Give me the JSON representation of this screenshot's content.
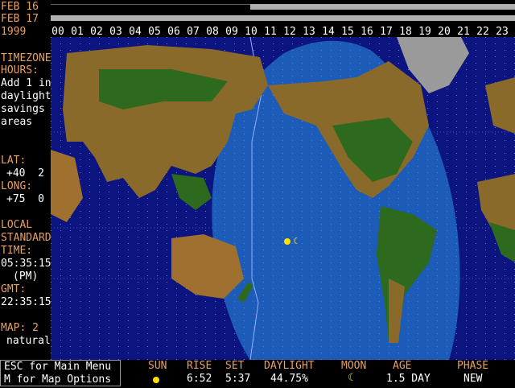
{
  "dates": {
    "row1_label": "FEB 16",
    "row2_label": "FEB 17",
    "year": "1999"
  },
  "hours": [
    "00",
    "01",
    "02",
    "03",
    "04",
    "05",
    "06",
    "07",
    "08",
    "09",
    "10",
    "11",
    "12",
    "13",
    "14",
    "15",
    "16",
    "17",
    "18",
    "19",
    "20",
    "21",
    "22",
    "23"
  ],
  "sidebar": {
    "timezone_title": [
      "TIMEZONE",
      "HOURS:"
    ],
    "timezone_note": [
      "Add 1 in",
      "daylight",
      "savings",
      "areas"
    ],
    "lat_label": "LAT:",
    "lat_value": "+40  2",
    "long_label": "LONG:",
    "long_value": "+75  0",
    "local_label": [
      "LOCAL",
      "STANDARD",
      "TIME:"
    ],
    "local_time": "05:35:15",
    "local_ampm": "(PM)",
    "gmt_label": "GMT:",
    "gmt_time": "22:35:15",
    "map_label": "MAP: 2",
    "map_name": "natural"
  },
  "footer": {
    "menu_line1": "ESC for Main Menu",
    "menu_line2": "M for Map Options",
    "sun_head": "SUN",
    "sun_icon": "sun-icon",
    "rise_head": "RISE",
    "rise_value": "6:52",
    "set_head": "SET",
    "set_value": "5:37",
    "daylight_head": "DAYLIGHT",
    "daylight_value": "44.75%",
    "moon_head": "MOON",
    "moon_icon": "crescent-moon-icon",
    "age_head": "AGE",
    "age_value": "1.5 DAY",
    "phase_head": "PHASE",
    "phase_value": "NEW"
  },
  "colors": {
    "ocean_night": "#0c1480",
    "ocean_day": "#1c5cb8",
    "land_brown": "#8a6a2a",
    "land_green": "#2e6a1e",
    "label_orange": "#e8a060",
    "sun_yellow": "#ffe000"
  }
}
